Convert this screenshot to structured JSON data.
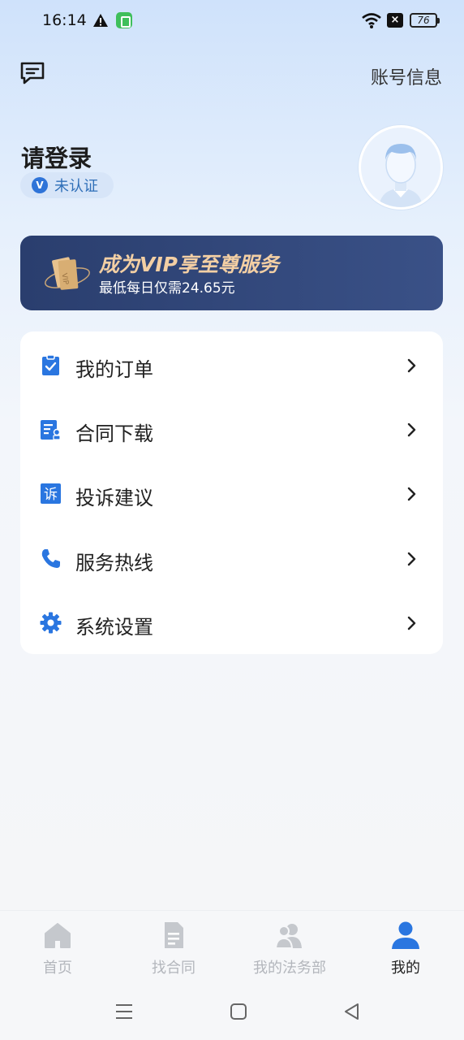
{
  "status_bar": {
    "time": "16:14",
    "battery": "76",
    "icons": [
      "warning-icon",
      "app-notification-icon",
      "wifi-icon",
      "sim-blocked-icon",
      "battery-icon"
    ]
  },
  "header": {
    "message_icon": "message-icon",
    "account_link": "账号信息"
  },
  "profile": {
    "title": "请登录",
    "badge": "未认证",
    "badge_icon": "V",
    "avatar_icon": "avatar-icon"
  },
  "vip_banner": {
    "title": "成为VIP享至尊服务",
    "subtitle": "最低每日仅需24.65元"
  },
  "menu": [
    {
      "label": "我的订单",
      "icon": "order-clipboard-icon"
    },
    {
      "label": "合同下载",
      "icon": "contract-download-icon"
    },
    {
      "label": "投诉建议",
      "icon": "complaint-icon",
      "icon_glyph": "诉"
    },
    {
      "label": "服务热线",
      "icon": "phone-icon"
    },
    {
      "label": "系统设置",
      "icon": "gear-icon"
    }
  ],
  "bottom_nav": [
    {
      "label": "首页",
      "icon": "home-icon",
      "active": false
    },
    {
      "label": "找合同",
      "icon": "document-icon",
      "active": false
    },
    {
      "label": "我的法务部",
      "icon": "team-icon",
      "active": false
    },
    {
      "label": "我的",
      "icon": "user-icon",
      "active": true
    }
  ],
  "system_nav": [
    "menu-icon",
    "home-square-icon",
    "back-triangle-icon"
  ],
  "colors": {
    "accent": "#2a76e0",
    "vip_gold": "#f3cfa4",
    "vip_bg": "#2f4478",
    "inactive": "#b3b6bc"
  }
}
